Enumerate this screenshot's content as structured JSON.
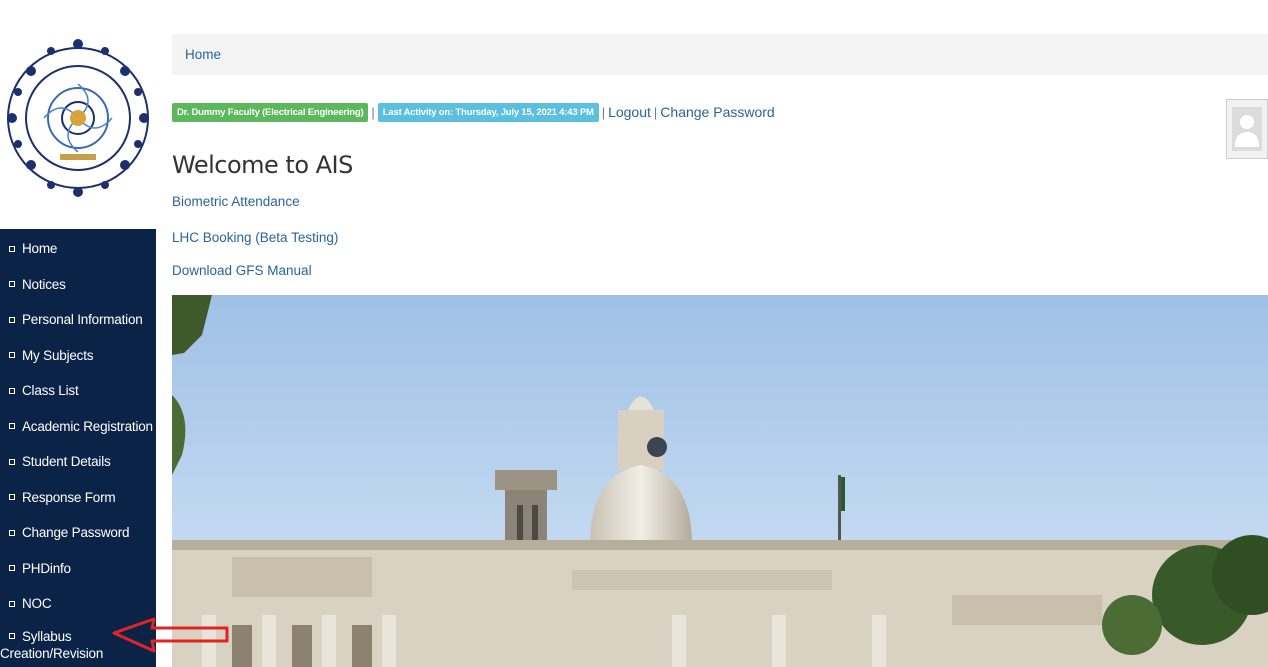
{
  "sidebar": {
    "logo_icon": "iit-roorkee-seal-logo",
    "items": [
      {
        "label": "Home"
      },
      {
        "label": "Notices"
      },
      {
        "label": "Personal Information"
      },
      {
        "label": "My Subjects"
      },
      {
        "label": "Class List"
      },
      {
        "label": "Academic Registration"
      },
      {
        "label": "Student Details"
      },
      {
        "label": "Response Form"
      },
      {
        "label": "Change Password"
      },
      {
        "label": "PHDinfo"
      },
      {
        "label": "NOC"
      }
    ],
    "last_item": {
      "label_line1": "Syllabus",
      "label_line2": "Creation/Revision"
    }
  },
  "breadcrumb": {
    "home": "Home"
  },
  "status": {
    "user_badge": "Dr. Dummy Faculty (Electrical Engineering)",
    "activity_badge": "Last Activity on: Thursday, July 15, 2021 4:43 PM",
    "logout": "Logout",
    "change_password": "Change Password",
    "separator": "|"
  },
  "main": {
    "welcome_title": "Welcome to AIS",
    "links": [
      {
        "label": "Biometric Attendance"
      },
      {
        "label": "LHC Booking (Beta Testing)"
      },
      {
        "label": "Download GFS Manual"
      }
    ]
  },
  "icons": {
    "avatar": "user-avatar-icon",
    "arrow": "red-arrow-annotation"
  },
  "colors": {
    "sidebar_bg": "#0c2348",
    "link": "#2a6496",
    "badge_green": "#5cb85c",
    "badge_blue": "#5bc0de",
    "arrow": "#e02424"
  }
}
